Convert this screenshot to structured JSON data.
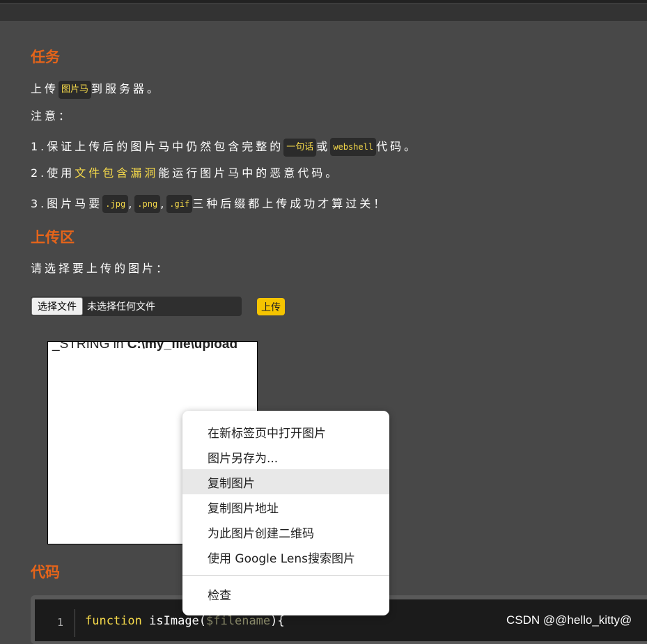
{
  "task": {
    "heading": "任务",
    "line1_pre": "上传",
    "line1_chip": "图片马",
    "line1_post": "到服务器。",
    "note": "注意：",
    "item1_pre": "1.保证上传后的图片马中仍然包含完整的",
    "item1_chip1": "一句话",
    "item1_mid": "或",
    "item1_chip2": "webshell",
    "item1_post": "代码。",
    "item2_pre": "2.使用",
    "item2_link": "文件包含漏洞",
    "item2_post": "能运行图片马中的恶意代码。",
    "item3_pre": "3.图片马要",
    "item3_chip1": ".jpg",
    "item3_sep1": ",",
    "item3_chip2": ".png",
    "item3_sep2": ",",
    "item3_chip3": ".gif",
    "item3_post": "三种后缀都上传成功才算过关！"
  },
  "upload": {
    "heading": "上传区",
    "prompt": "请选择要上传的图片：",
    "choose_button": "选择文件",
    "file_status": "未选择任何文件",
    "submit_button": "上传"
  },
  "preview": {
    "text_pre": "_STRING in ",
    "text_bold": "C:\\my_file\\upload"
  },
  "context_menu": {
    "items": [
      "在新标签页中打开图片",
      "图片另存为...",
      "复制图片",
      "复制图片地址",
      "为此图片创建二维码",
      "使用 Google Lens搜索图片"
    ],
    "inspect": "检查",
    "highlighted_index": 2
  },
  "code": {
    "heading": "代码",
    "line_number": "1",
    "keyword": "function",
    "func_name": "isImage(",
    "param": "$filename",
    "tail": "){"
  },
  "watermark": "CSDN @@hello_kitty@"
}
